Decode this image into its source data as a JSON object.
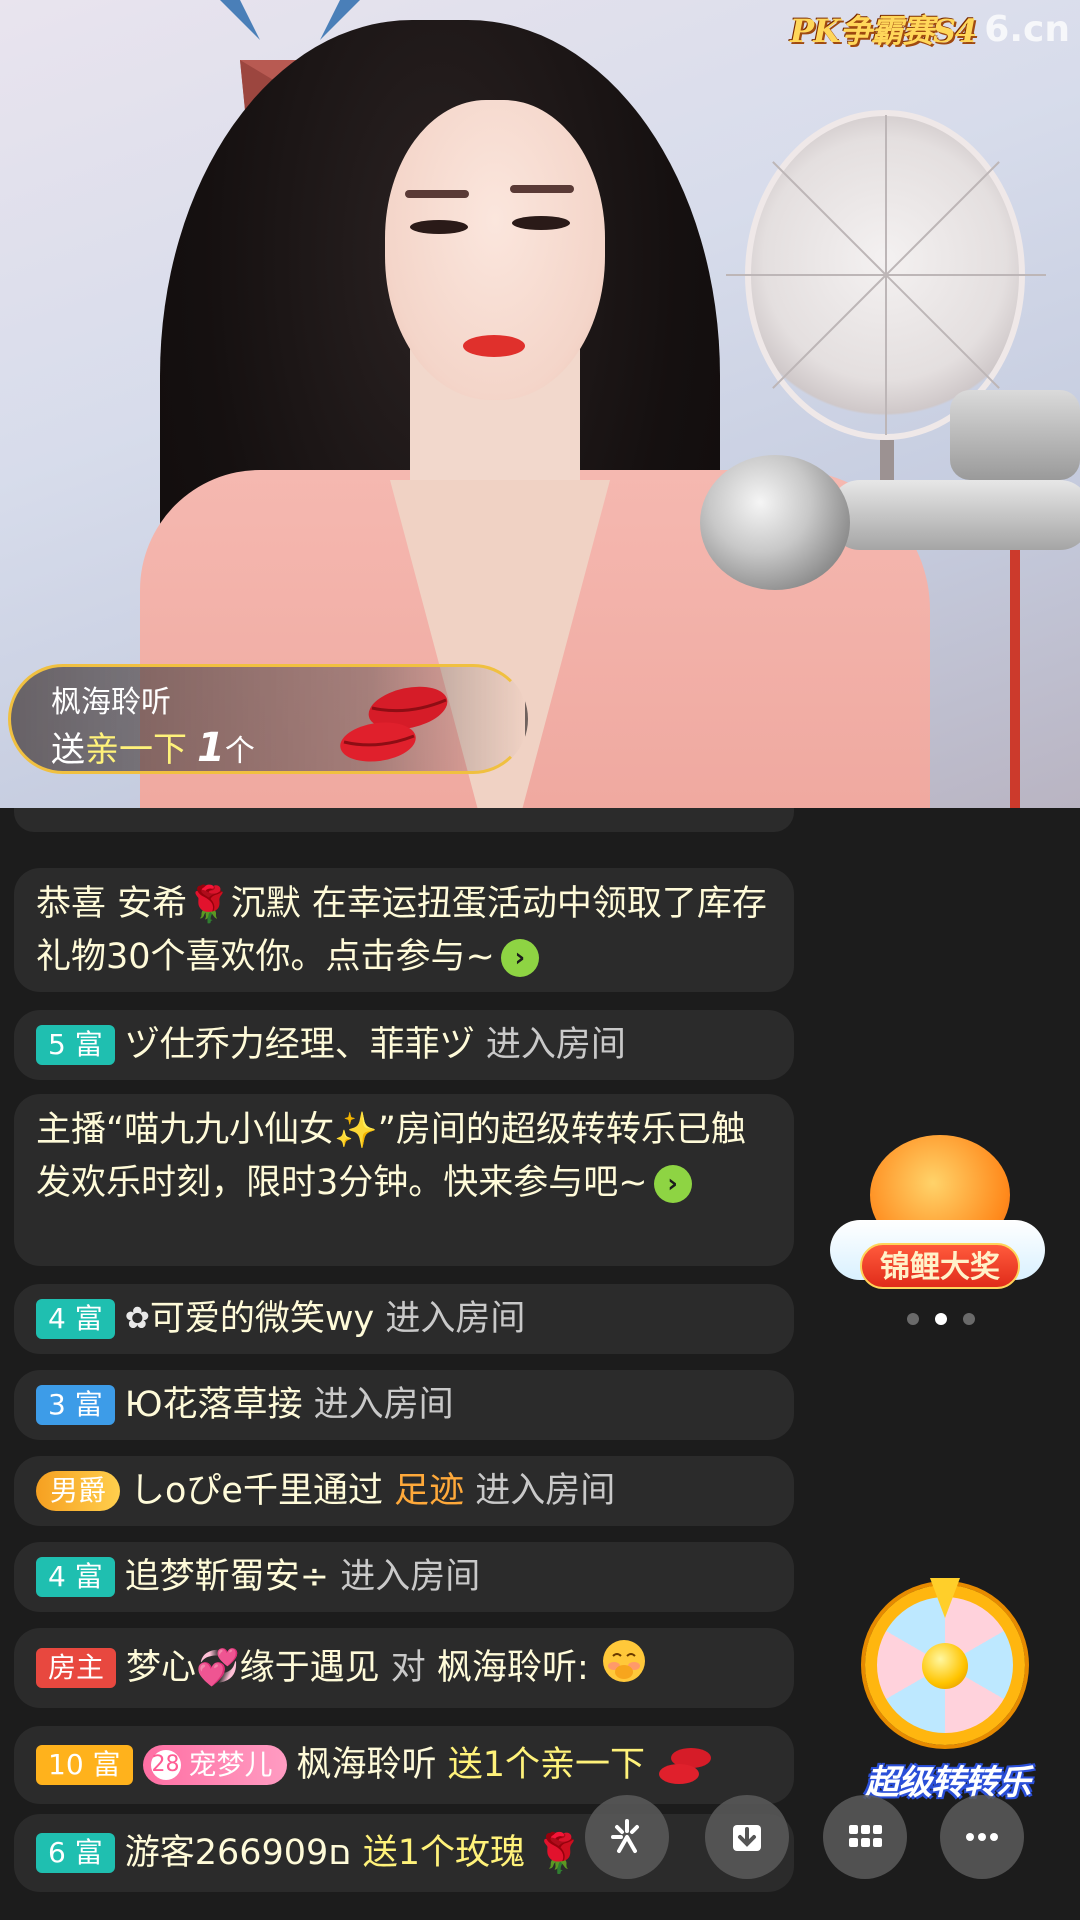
{
  "watermark": {
    "event": "PK争霸赛S4",
    "brand": "6.cn"
  },
  "gift_banner": {
    "sender": "枫海聆听",
    "action": "送",
    "gift": "亲一下",
    "count": "1",
    "unit": "个"
  },
  "chat": [
    {
      "id": "m1",
      "text_a": "恭喜 安希",
      "emoji": "🌹",
      "text_b": "沉默 在幸运扭蛋活动中领取了库存礼物30个喜欢你。点击参与~"
    },
    {
      "id": "m2",
      "badge": "5 富",
      "user": "ヅ仕乔力经理、菲菲ヅ",
      "action": "进入房间"
    },
    {
      "id": "m3",
      "text_a": "主播“喵九九小仙女",
      "emoji": "✨",
      "text_b": "”房间的超级转转乐已触发欢乐时刻，限时3分钟。快来参与吧~"
    },
    {
      "id": "m4",
      "badge": "4 富",
      "user": "可爱的微笑wy",
      "action": "进入房间"
    },
    {
      "id": "m5",
      "badge": "3 富",
      "user": "Ю花落草接",
      "action": "进入房间"
    },
    {
      "id": "m6",
      "badge": "男爵",
      "user": "しoぴe千里",
      "via": "通过",
      "via_item": "足迹",
      "action": "进入房间"
    },
    {
      "id": "m7",
      "badge": "4 富",
      "user": "追梦靳蜀安÷",
      "action": "进入房间"
    },
    {
      "id": "m8",
      "badge": "房主",
      "user": "梦心",
      "emoji": "💞",
      "user_b": "缘于遇见",
      "to": "对",
      "target": "枫海聆听:"
    },
    {
      "id": "m9",
      "badge": "10 富",
      "pet_badge": "宠梦儿",
      "pet_level": "28",
      "user": "枫海聆听",
      "gift": "送1个亲一下"
    },
    {
      "id": "m10",
      "badge": "6 富",
      "user": "游客266909ם",
      "gift": "送1个玫瑰"
    }
  ],
  "side": {
    "koi_label": "锦鲤大奖",
    "wheel_label": "超级转转乐",
    "carousel_active": 1
  },
  "toolbar": [
    "share-icon",
    "download-icon",
    "grid-icon",
    "more-icon"
  ]
}
